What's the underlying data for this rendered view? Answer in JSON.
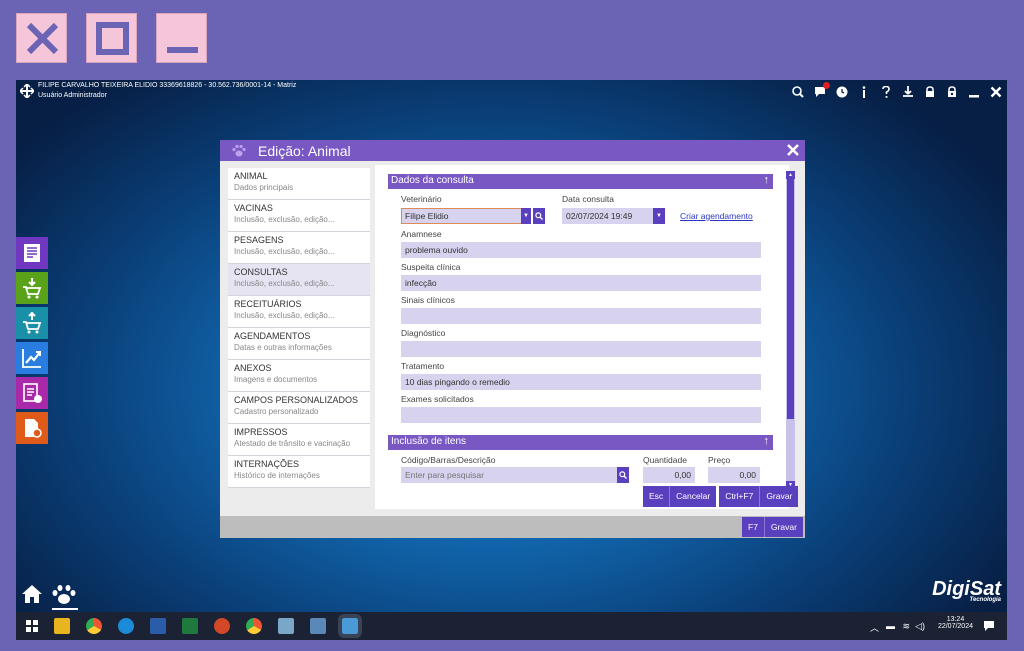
{
  "window_controls": {
    "close_icon": "close-x-icon",
    "maximize_icon": "maximize-icon",
    "minimize_icon": "minimize-icon"
  },
  "header": {
    "company": "FILIPE CARVALHO TEIXEIRA ELIDIO 33369618826 - 30.562.736/0001-14 - Matriz",
    "user": "Usuário Administrador"
  },
  "header_icons": [
    "search-icon",
    "notifications-icon",
    "clock-icon",
    "info-icon",
    "help-icon",
    "user-switch-icon",
    "lock-icon",
    "lock-lock-icon",
    "minimize-icon",
    "close-icon"
  ],
  "dialog": {
    "title": "Edição: Animal",
    "nav": [
      {
        "label": "ANIMAL",
        "sub": "Dados principais"
      },
      {
        "label": "VACINAS",
        "sub": "Inclusão, exclusão, edição..."
      },
      {
        "label": "PESAGENS",
        "sub": "Inclusão, exclusão, edição..."
      },
      {
        "label": "CONSULTAS",
        "sub": "Inclusão, exclusão, edição..."
      },
      {
        "label": "RECEITUÁRIOS",
        "sub": "Inclusão, exclusão, edição..."
      },
      {
        "label": "AGENDAMENTOS",
        "sub": "Datas e outras informações"
      },
      {
        "label": "ANEXOS",
        "sub": "Imagens e documentos"
      },
      {
        "label": "CAMPOS PERSONALIZADOS",
        "sub": "Cadastro personalizado"
      },
      {
        "label": "IMPRESSOS",
        "sub": "Atestado de trânsito e vacinação"
      },
      {
        "label": "INTERNAÇÕES",
        "sub": "Histórico de internações"
      }
    ],
    "selected_nav": "CONSULTAS",
    "consulta": {
      "section_title": "Dados da consulta",
      "veterinario_label": "Veterinário",
      "veterinario_value": "Filipe Elidio",
      "data_label": "Data consulta",
      "data_value": "02/07/2024 19:49",
      "criar_agendamento": "Criar agendamento",
      "anamnese_label": "Anamnese",
      "anamnese_value": "problema ouvido",
      "suspeita_label": "Suspeita clínica",
      "suspeita_value": "infecção",
      "sinais_label": "Sinais clínicos",
      "sinais_value": "",
      "diagnostico_label": "Diagnóstico",
      "diagnostico_value": "",
      "tratamento_label": "Tratamento",
      "tratamento_value": "10 dias pingando o remedio",
      "exames_label": "Exames solicitados",
      "exames_value": ""
    },
    "itens": {
      "section_title": "Inclusão de itens",
      "codigo_label": "Código/Barras/Descrição",
      "codigo_placeholder": "Enter para pesquisar",
      "quantidade_label": "Quantidade",
      "quantidade_value": "0,00",
      "preco_label": "Preço",
      "preco_value": "0,00"
    },
    "buttons": {
      "esc_key": "Esc",
      "esc_label": "Cancelar",
      "save_key": "Ctrl+F7",
      "save_label": "Gravar",
      "footer_key": "F7",
      "footer_label": "Gravar"
    }
  },
  "brand": {
    "name": "DigiSat",
    "sub": "Tecnologia"
  },
  "taskbar": {
    "time": "13:24",
    "date": "22/07/2024"
  },
  "colors": {
    "accent": "#7a58c4",
    "accent_dark": "#5a3fbf",
    "field": "#d7d2ee",
    "outer": "#6b63b3"
  }
}
